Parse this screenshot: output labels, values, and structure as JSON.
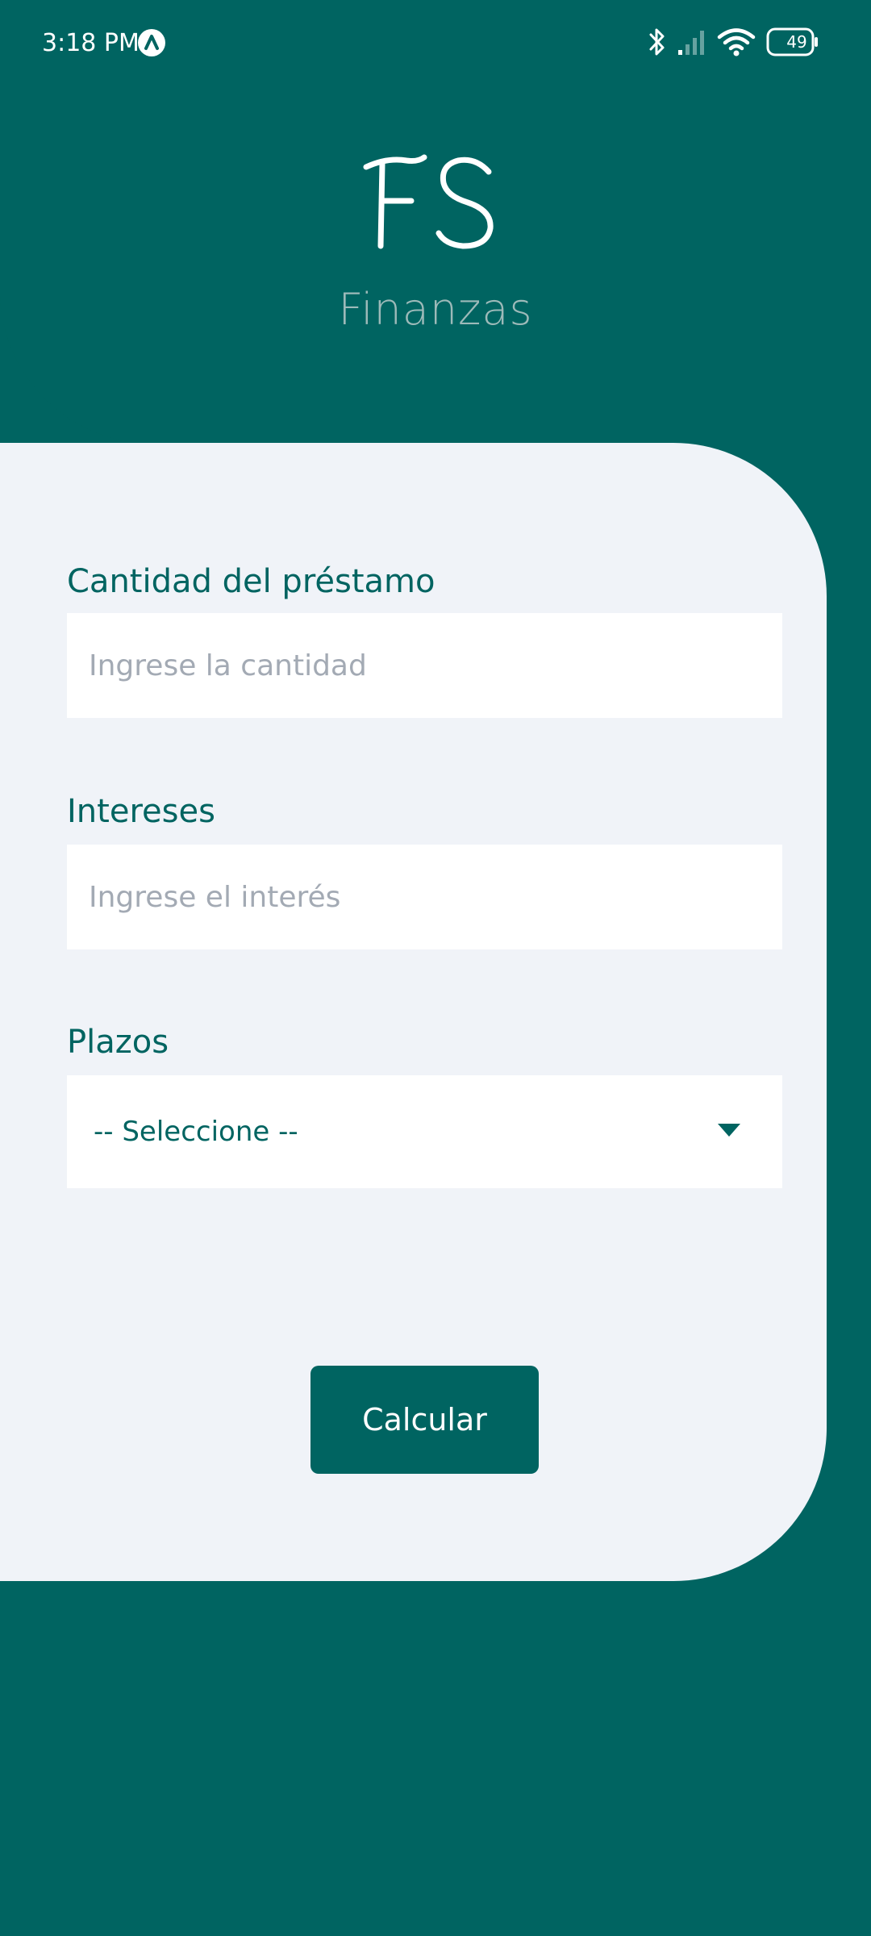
{
  "status_bar": {
    "time": "3:18 PM",
    "battery": "49",
    "icons": [
      "app-logo-icon",
      "bluetooth-icon",
      "signal-icon",
      "wifi-icon",
      "battery-icon"
    ]
  },
  "header": {
    "logo_text": "FS",
    "app_name": "Finanzas"
  },
  "form": {
    "amount": {
      "label": "Cantidad del préstamo",
      "placeholder": "Ingrese la cantidad",
      "value": ""
    },
    "interest": {
      "label": "Intereses",
      "placeholder": "Ingrese el interés",
      "value": ""
    },
    "terms": {
      "label": "Plazos",
      "selected": "-- Seleccione --",
      "icon": "caret-down-icon"
    },
    "submit_label": "Calcular"
  },
  "colors": {
    "primary": "#006461",
    "card_background": "#f0f3f8",
    "placeholder": "#a3aab4",
    "subtitle": "#9dbab9"
  }
}
